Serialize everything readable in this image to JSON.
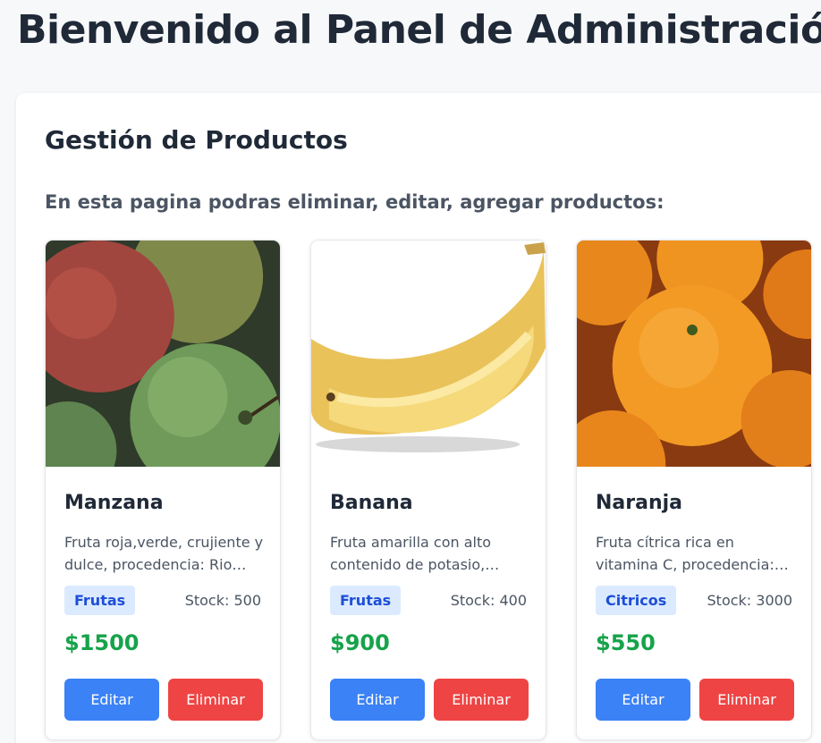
{
  "header": {
    "title": "Bienvenido al Panel de Administración"
  },
  "section": {
    "title": "Gestión de Productos",
    "description": "En esta pagina podras eliminar, editar, agregar productos:"
  },
  "products": [
    {
      "name": "Manzana",
      "description": "Fruta roja,verde, crujiente y dulce, procedencia: Rio Negro",
      "category": "Frutas",
      "stock": "Stock: 500",
      "price": "$1500",
      "edit_label": "Editar",
      "delete_label": "Eliminar"
    },
    {
      "name": "Banana",
      "description": "Fruta amarilla con alto contenido de potasio, procedencia: Ecuador",
      "category": "Frutas",
      "stock": "Stock: 400",
      "price": "$900",
      "edit_label": "Editar",
      "delete_label": "Eliminar"
    },
    {
      "name": "Naranja",
      "description": "Fruta cítrica rica en vitamina C, procedencia: Entre Rios",
      "category": "Citricos",
      "stock": "Stock: 3000",
      "price": "$550",
      "edit_label": "Editar",
      "delete_label": "Eliminar"
    }
  ],
  "colors": {
    "primary_button": "#3b82f6",
    "danger_button": "#ef4444",
    "price": "#16a34a",
    "tag_background": "#dbeafe",
    "tag_text": "#1d4ed8"
  }
}
